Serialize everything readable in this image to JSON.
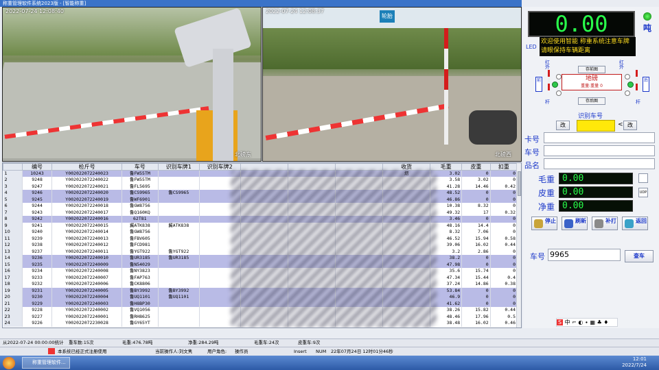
{
  "window": {
    "title": "称重管理软件系统2023版 - [智能称重]"
  },
  "cameras": [
    {
      "timestamp": "2022-07-24 12:08:40",
      "name": "北磅东"
    },
    {
      "timestamp": "2022-07-24 12:08:37",
      "name": "北磅西",
      "sign": "轮胎"
    }
  ],
  "grid": {
    "columns": [
      "",
      "编号",
      "检斤号",
      "车号",
      "识别车牌1",
      "识别车牌2",
      "",
      "",
      "",
      "收货",
      "毛重",
      "皮重",
      "扣重"
    ],
    "rows": [
      {
        "n": "1",
        "id": "10243",
        "code": "Y002022072240023",
        "car": "鲁FW55TM",
        "p1": "",
        "p2": "",
        "recv": "烟",
        "gross": "3.02",
        "tare": "0",
        "ded": "0",
        "hl": true
      },
      {
        "n": "2",
        "id": "9248",
        "code": "Y002022072240022",
        "car": "鲁FW55TM",
        "p1": "",
        "p2": "",
        "recv": "",
        "gross": "3.58",
        "tare": "3.02",
        "ded": "0",
        "hl": false
      },
      {
        "n": "3",
        "id": "9247",
        "code": "Y002022072240021",
        "car": "鲁FL5695",
        "p1": "",
        "p2": "",
        "recv": "",
        "gross": "41.28",
        "tare": "14.46",
        "ded": "0.42",
        "hl": false
      },
      {
        "n": "4",
        "id": "9246",
        "code": "Y002022072240020",
        "car": "鲁CS9965",
        "p1": "鲁CS9965",
        "p2": "",
        "recv": "",
        "gross": "48.52",
        "tare": "0",
        "ded": "0",
        "hl": true
      },
      {
        "n": "5",
        "id": "9245",
        "code": "Y002022072240019",
        "car": "鲁WF6901",
        "p1": "",
        "p2": "",
        "recv": "",
        "gross": "46.86",
        "tare": "0",
        "ded": "0",
        "hl": true
      },
      {
        "n": "6",
        "id": "9244",
        "code": "Y002022072240018",
        "car": "鲁GW8756",
        "p1": "",
        "p2": "",
        "recv": "",
        "gross": "10.38",
        "tare": "8.32",
        "ded": "0",
        "hl": false
      },
      {
        "n": "7",
        "id": "9243",
        "code": "Y002022072240017",
        "car": "鲁Q160KQ",
        "p1": "",
        "p2": "",
        "recv": "",
        "gross": "49.32",
        "tare": "17",
        "ded": "0.32",
        "hl": false
      },
      {
        "n": "8",
        "id": "9242",
        "code": "Y002022072240016",
        "car": "62T81",
        "p1": "",
        "p2": "",
        "recv": "",
        "gross": "3.46",
        "tare": "0",
        "ded": "0",
        "hl": true
      },
      {
        "n": "9",
        "id": "9241",
        "code": "Y002022072240015",
        "car": "冀ATK838",
        "p1": "冀ATK838",
        "p2": "",
        "recv": "",
        "gross": "48.16",
        "tare": "14.4",
        "ded": "0",
        "hl": false
      },
      {
        "n": "10",
        "id": "9240",
        "code": "Y002022072240014",
        "car": "鲁GW8756",
        "p1": "",
        "p2": "",
        "recv": "",
        "gross": "8.32",
        "tare": "7.06",
        "ded": "0",
        "hl": false
      },
      {
        "n": "11",
        "id": "9239",
        "code": "Y002022072240013",
        "car": "鲁FBV605",
        "p1": "",
        "p2": "",
        "recv": "",
        "gross": "46.52",
        "tare": "15.94",
        "ded": "0.58",
        "hl": false
      },
      {
        "n": "12",
        "id": "9238",
        "code": "Y002022072240012",
        "car": "鲁FCD981",
        "p1": "",
        "p2": "",
        "recv": "",
        "gross": "39.06",
        "tare": "16.02",
        "ded": "0.44",
        "hl": false
      },
      {
        "n": "13",
        "id": "9237",
        "code": "Y002022072240011",
        "car": "鲁YGT922",
        "p1": "鲁YGT922",
        "p2": "",
        "recv": "",
        "gross": "3.2",
        "tare": "2.86",
        "ded": "0",
        "hl": false
      },
      {
        "n": "14",
        "id": "9236",
        "code": "Y002022072240010",
        "car": "鲁UR3185",
        "p1": "鲁UR3185",
        "p2": "",
        "recv": "",
        "gross": "38.2",
        "tare": "0",
        "ded": "0",
        "hl": true
      },
      {
        "n": "15",
        "id": "9235",
        "code": "Y002022072240009",
        "car": "鲁N54029",
        "p1": "",
        "p2": "",
        "recv": "",
        "gross": "47.98",
        "tare": "0",
        "ded": "0",
        "hl": true
      },
      {
        "n": "16",
        "id": "9234",
        "code": "Y002022072240008",
        "car": "鲁NY3823",
        "p1": "",
        "p2": "",
        "recv": "",
        "gross": "35.6",
        "tare": "15.74",
        "ded": "0",
        "hl": false
      },
      {
        "n": "17",
        "id": "9233",
        "code": "Y002022072240007",
        "car": "鲁FAP763",
        "p1": "",
        "p2": "",
        "recv": "",
        "gross": "47.34",
        "tare": "15.44",
        "ded": "0.4",
        "hl": false
      },
      {
        "n": "18",
        "id": "9232",
        "code": "Y002022072240006",
        "car": "鲁CK8806",
        "p1": "",
        "p2": "",
        "recv": "",
        "gross": "37.24",
        "tare": "14.86",
        "ded": "0.38",
        "hl": false
      },
      {
        "n": "19",
        "id": "9231",
        "code": "Y002022072240005",
        "car": "鲁BY3992",
        "p1": "鲁BY3992",
        "p2": "",
        "recv": "",
        "gross": "53.84",
        "tare": "0",
        "ded": "0",
        "hl": true
      },
      {
        "n": "20",
        "id": "9230",
        "code": "Y002022072240004",
        "car": "鲁UQ1101",
        "p1": "鲁UQ1101",
        "p2": "",
        "recv": "",
        "gross": "46.9",
        "tare": "0",
        "ded": "0",
        "hl": true
      },
      {
        "n": "21",
        "id": "9229",
        "code": "Y002022072240003",
        "car": "鲁H8BP30",
        "p1": "",
        "p2": "",
        "recv": "",
        "gross": "41.62",
        "tare": "0",
        "ded": "0",
        "hl": true
      },
      {
        "n": "22",
        "id": "9228",
        "code": "Y002022072240002",
        "car": "鲁VQ1056",
        "p1": "",
        "p2": "",
        "recv": "",
        "gross": "38.26",
        "tare": "15.82",
        "ded": "0.44",
        "hl": false
      },
      {
        "n": "23",
        "id": "9227",
        "code": "Y002022072240001",
        "car": "鲁RH8625",
        "p1": "",
        "p2": "",
        "recv": "",
        "gross": "48.46",
        "tare": "17.96",
        "ded": "0.5",
        "hl": false
      },
      {
        "n": "24",
        "id": "9226",
        "code": "Y002022072230028",
        "car": "鲁GY65YT",
        "p1": "",
        "p2": "",
        "recv": "",
        "gross": "38.48",
        "tare": "16.02",
        "ded": "0.46",
        "hl": false
      }
    ]
  },
  "panel": {
    "display": "0.00",
    "unit": "吨",
    "led_label": "LED",
    "marquee": "欢迎使用智能 称重系统注意车牌请眼保持车辆距离",
    "scale": {
      "title": "地磅",
      "subtitle": "重量:重量",
      "zero": "0",
      "front_btn": "存前图",
      "back_btn": "存后图",
      "red_left": "红外",
      "red_right": "红外",
      "side_left": "前",
      "side_right": "后",
      "pole_left": "杆",
      "pole_right": "杆"
    },
    "plate": {
      "title": "识别车号",
      "change": "改",
      "change2": "改",
      "arrow": "<"
    },
    "fields": [
      {
        "label": "卡号",
        "value": ""
      },
      {
        "label": "车号",
        "value": ""
      },
      {
        "label": "品名",
        "value": ""
      }
    ],
    "weights": [
      {
        "label": "毛重",
        "value": "0.00"
      },
      {
        "label": "皮重",
        "value": "0.00"
      },
      {
        "label": "净重",
        "value": "0.00"
      }
    ],
    "udp": "UDP",
    "buttons": [
      {
        "label": "停止",
        "color": "#c8a43a"
      },
      {
        "label": "刷新",
        "color": "#3a62c8"
      },
      {
        "label": "补打",
        "color": "#8a8a8a"
      },
      {
        "label": "返回",
        "color": "#3aa2c8"
      }
    ],
    "car_query": {
      "label": "车号",
      "value": "9965",
      "button": "查车"
    },
    "ime": "中 ⌐ ◐ ∙ ▦ ♣ ♦"
  },
  "status1": {
    "range": "从2022-07-24 00:00:00统计",
    "heavy": "重车数:15次",
    "gross": "毛重:476.78吨",
    "net": "净重:284.29吨",
    "cars": "毛重车:24次",
    "tare": "皮重车:9次"
  },
  "status2": {
    "notice": "本系统已经正式注册使用",
    "operator": "当前操作人:刘文隽",
    "role": "用户角色:",
    "role_val": "操作员",
    "insert": "Insert",
    "num": "NUM",
    "datetime": "22年07月24日 12时01分46秒"
  },
  "taskbar": {
    "app": "称重管理软件...",
    "time": "12:01",
    "date": "2022/7/24"
  }
}
